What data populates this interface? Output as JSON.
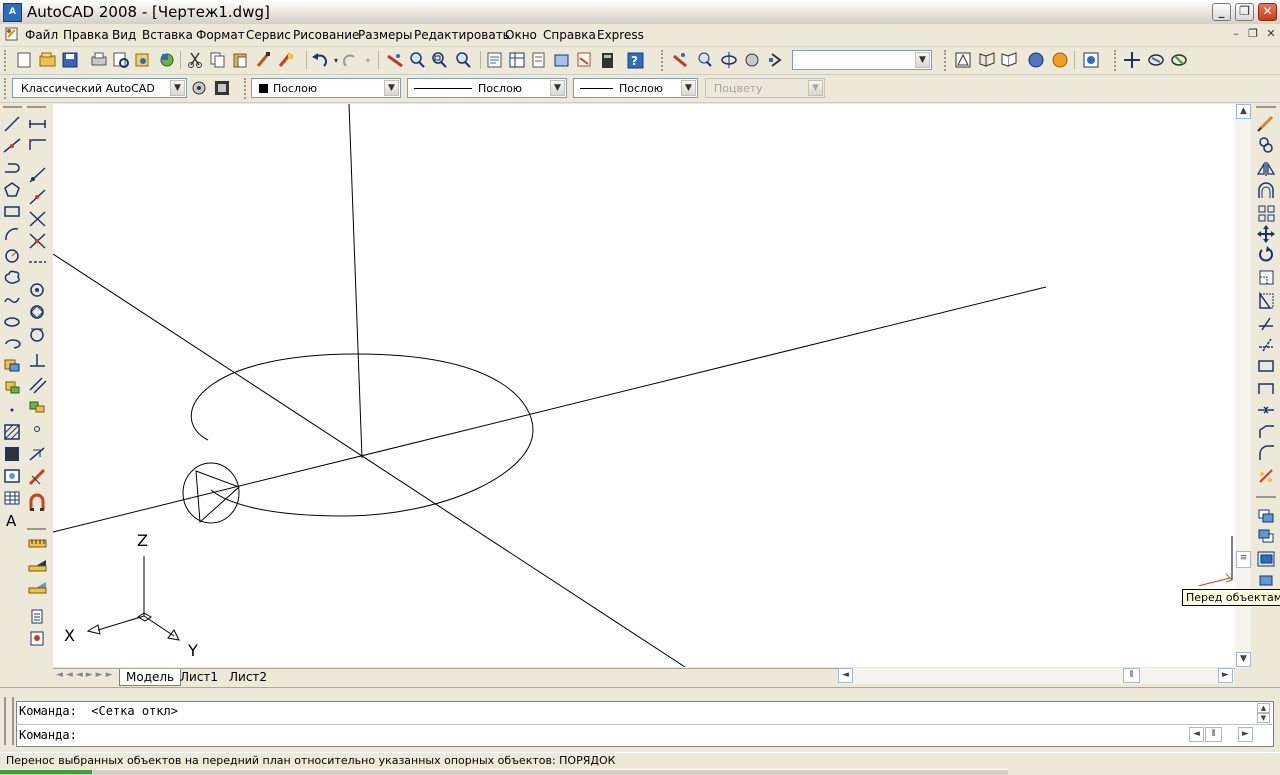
{
  "window": {
    "title": "AutoCAD 2008 - [Чертеж1.dwg]",
    "app_icon_text": "A"
  },
  "menu": {
    "items": [
      "Файл",
      "Правка",
      "Вид",
      "Вставка",
      "Формат",
      "Сервис",
      "Рисование",
      "Размеры",
      "Редактировать",
      "Окно",
      "Справка",
      "Express"
    ]
  },
  "toolbar": {
    "workspace": "Классический AutoCAD",
    "layer_color": "Послою",
    "linetype": "Послою",
    "lineweight": "Послою",
    "plotstyle": "Поцвету",
    "view_combo": ""
  },
  "ucs": {
    "x": "X",
    "y": "Y",
    "z": "Z"
  },
  "tabs": {
    "model": "Модель",
    "layout1": "Лист1",
    "layout2": "Лист2"
  },
  "command": {
    "history": "Команда:  <Сетка откл>",
    "prompt": "Команда:"
  },
  "status": {
    "text": "Перенос выбранных объектов на передний план относительно указанных опорных объектов:  ПОРЯДОК"
  },
  "tooltip": {
    "text": "Перед объектами"
  },
  "colors": {
    "background": "#ece9d8",
    "canvas": "#ffffff",
    "titlebar_close": "#c5401b"
  }
}
